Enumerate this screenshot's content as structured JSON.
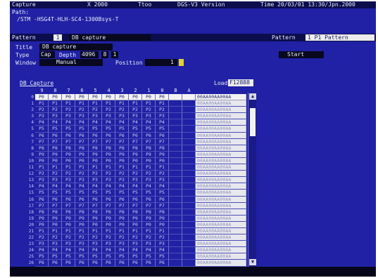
{
  "status": {
    "mode": "Capture",
    "target": "X 2000",
    "macro": "Ttoo",
    "version_info": "DGS-V3 Version",
    "time_label": "Time",
    "time": "20/03/01 13:30/Jpn.2000"
  },
  "path": {
    "label": "Path:",
    "value": "/STM -HSG4T-HLH-SC4-1300Bsys-T"
  },
  "header_bar": {
    "left": "Pattern",
    "num": "1",
    "title": "DB capture",
    "right_label": "Pattern",
    "right_value": "1 P1 Pattern"
  },
  "form": {
    "title_label": "Title",
    "title_value": "DB capture",
    "type_label": "Type",
    "type_value": "Cap",
    "depth_label": "Depth",
    "depth_value": "4096",
    "count_value": "8",
    "count2_value": "1",
    "window_label": "Window",
    "window_value": "Manual",
    "position_label": "Position",
    "position_value": "1",
    "start_button": "Start"
  },
  "table": {
    "title": "DB Capture",
    "load_label": "Load",
    "load_value": "F12888",
    "columns": [
      "9",
      "8",
      "7",
      "6",
      "5",
      "4",
      "3",
      "2",
      "1",
      "0",
      "B",
      "A",
      ""
    ],
    "rows": [
      {
        "n": "0",
        "cells": [
          "P0",
          "P0",
          "P0",
          "P0",
          "P0",
          "P0",
          "P0",
          "P0",
          "P0",
          "P0",
          "",
          "",
          "00AA00AA00AA"
        ],
        "selected": true
      },
      {
        "n": "1",
        "cells": [
          "P1",
          "P1",
          "P1",
          "P1",
          "P1",
          "P1",
          "P1",
          "P1",
          "P1",
          "P1",
          "",
          "",
          "00AA00AA00AA"
        ]
      },
      {
        "n": "2",
        "cells": [
          "P2",
          "P2",
          "P2",
          "P2",
          "P2",
          "P2",
          "P2",
          "P2",
          "P2",
          "P2",
          "",
          "",
          "00AA00AA00AA"
        ]
      },
      {
        "n": "3",
        "cells": [
          "P3",
          "P3",
          "P3",
          "P3",
          "P3",
          "P3",
          "P3",
          "P3",
          "P3",
          "P3",
          "",
          "",
          "00AA00AA00AA"
        ]
      },
      {
        "n": "4",
        "cells": [
          "P4",
          "P4",
          "P4",
          "P4",
          "P4",
          "P4",
          "P4",
          "P4",
          "P4",
          "P4",
          "",
          "",
          "00AA00AA00AA"
        ]
      },
      {
        "n": "5",
        "cells": [
          "P5",
          "P5",
          "P5",
          "P5",
          "P5",
          "P5",
          "P5",
          "P5",
          "P5",
          "P5",
          "",
          "",
          "00AA00AA00AA"
        ]
      },
      {
        "n": "6",
        "cells": [
          "P6",
          "P6",
          "P6",
          "P6",
          "P6",
          "P6",
          "P6",
          "P6",
          "P6",
          "P6",
          "",
          "",
          "00AA00AA00AA"
        ]
      },
      {
        "n": "7",
        "cells": [
          "P7",
          "P7",
          "P7",
          "P7",
          "P7",
          "P7",
          "P7",
          "P7",
          "P7",
          "P7",
          "",
          "",
          "00AA00AA00AA"
        ]
      },
      {
        "n": "8",
        "cells": [
          "P8",
          "P8",
          "P8",
          "P8",
          "P8",
          "P8",
          "P8",
          "P8",
          "P8",
          "P8",
          "",
          "",
          "00AA00AA00AA"
        ]
      },
      {
        "n": "9",
        "cells": [
          "P9",
          "P9",
          "P9",
          "P9",
          "P9",
          "P9",
          "P9",
          "P9",
          "P9",
          "P9",
          "",
          "",
          "00AA00AA00AA"
        ]
      },
      {
        "n": "10",
        "cells": [
          "P0",
          "P0",
          "P0",
          "P0",
          "P0",
          "P0",
          "P0",
          "P0",
          "P0",
          "P0",
          "",
          "",
          "00AA00AA00AA"
        ]
      },
      {
        "n": "11",
        "cells": [
          "P1",
          "P1",
          "P1",
          "P1",
          "P1",
          "P1",
          "P1",
          "P1",
          "P1",
          "P1",
          "",
          "",
          "00AA00AA00AA"
        ]
      },
      {
        "n": "12",
        "cells": [
          "P2",
          "P2",
          "P2",
          "P2",
          "P2",
          "P2",
          "P2",
          "P2",
          "P2",
          "P2",
          "",
          "",
          "00AA00AA00AA"
        ]
      },
      {
        "n": "13",
        "cells": [
          "P3",
          "P3",
          "P3",
          "P3",
          "P3",
          "P3",
          "P3",
          "P3",
          "P3",
          "P3",
          "",
          "",
          "00AA00AA00AA"
        ]
      },
      {
        "n": "14",
        "cells": [
          "P4",
          "P4",
          "P4",
          "P4",
          "P4",
          "P4",
          "P4",
          "P4",
          "P4",
          "P4",
          "",
          "",
          "00AA00AA00AA"
        ]
      },
      {
        "n": "15",
        "cells": [
          "P5",
          "P5",
          "P5",
          "P5",
          "P5",
          "P5",
          "P5",
          "P5",
          "P5",
          "P5",
          "",
          "",
          "00AA00AA00AA"
        ]
      },
      {
        "n": "16",
        "cells": [
          "P6",
          "P6",
          "P6",
          "P6",
          "P6",
          "P6",
          "P6",
          "P6",
          "P6",
          "P6",
          "",
          "",
          "00AA00AA00AA"
        ]
      },
      {
        "n": "17",
        "cells": [
          "P7",
          "P7",
          "P7",
          "P7",
          "P7",
          "P7",
          "P7",
          "P7",
          "P7",
          "P7",
          "",
          "",
          "00AA00AA00AA"
        ]
      },
      {
        "n": "18",
        "cells": [
          "P8",
          "P8",
          "P8",
          "P8",
          "P8",
          "P8",
          "P8",
          "P8",
          "P8",
          "P8",
          "",
          "",
          "00AA00AA00AA"
        ]
      },
      {
        "n": "19",
        "cells": [
          "P9",
          "P9",
          "P9",
          "P9",
          "P9",
          "P9",
          "P9",
          "P9",
          "P9",
          "P9",
          "",
          "",
          "00AA00AA00AA"
        ]
      },
      {
        "n": "20",
        "cells": [
          "P0",
          "P0",
          "P0",
          "P0",
          "P0",
          "P0",
          "P0",
          "P0",
          "P0",
          "P0",
          "",
          "",
          "00AA00AA00AA"
        ]
      },
      {
        "n": "21",
        "cells": [
          "P1",
          "P1",
          "P1",
          "P1",
          "P1",
          "P1",
          "P1",
          "P1",
          "P1",
          "P1",
          "",
          "",
          "00AA00AA00AA"
        ]
      },
      {
        "n": "22",
        "cells": [
          "P2",
          "P2",
          "P2",
          "P2",
          "P2",
          "P2",
          "P2",
          "P2",
          "P2",
          "P2",
          "",
          "",
          "00AA00AA00AA"
        ]
      },
      {
        "n": "23",
        "cells": [
          "P3",
          "P3",
          "P3",
          "P3",
          "P3",
          "P3",
          "P3",
          "P3",
          "P3",
          "P3",
          "",
          "",
          "00AA00AA00AA"
        ]
      },
      {
        "n": "24",
        "cells": [
          "P4",
          "P4",
          "P4",
          "P4",
          "P4",
          "P4",
          "P4",
          "P4",
          "P4",
          "P4",
          "",
          "",
          "00AA00AA00AA"
        ]
      },
      {
        "n": "25",
        "cells": [
          "P5",
          "P5",
          "P5",
          "P5",
          "P5",
          "P5",
          "P5",
          "P5",
          "P5",
          "P5",
          "",
          "",
          "00AA00AA00AA"
        ]
      },
      {
        "n": "26",
        "cells": [
          "P6",
          "P6",
          "P6",
          "P6",
          "P6",
          "P6",
          "P6",
          "P6",
          "P6",
          "P6",
          "",
          "",
          "00AA00AA00AA"
        ]
      }
    ]
  },
  "scrollbar": {
    "up_icon": "triangle-up",
    "down_icon": "triangle-down"
  },
  "colors": {
    "screen_bg": "#2021a5",
    "bar_bg": "#0c0d4d",
    "highlight": "#e3d12e",
    "data_cell_bg": "#e7e7ee"
  }
}
